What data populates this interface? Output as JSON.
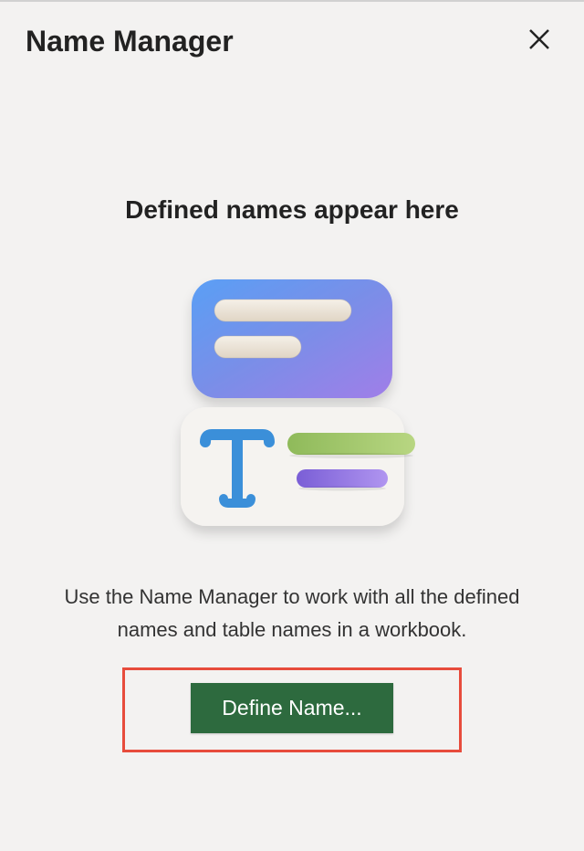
{
  "header": {
    "title": "Name Manager"
  },
  "content": {
    "heading": "Defined names appear here",
    "description": "Use the Name Manager to work with all the defined names and table names in a workbook.",
    "button_label": "Define Name..."
  }
}
